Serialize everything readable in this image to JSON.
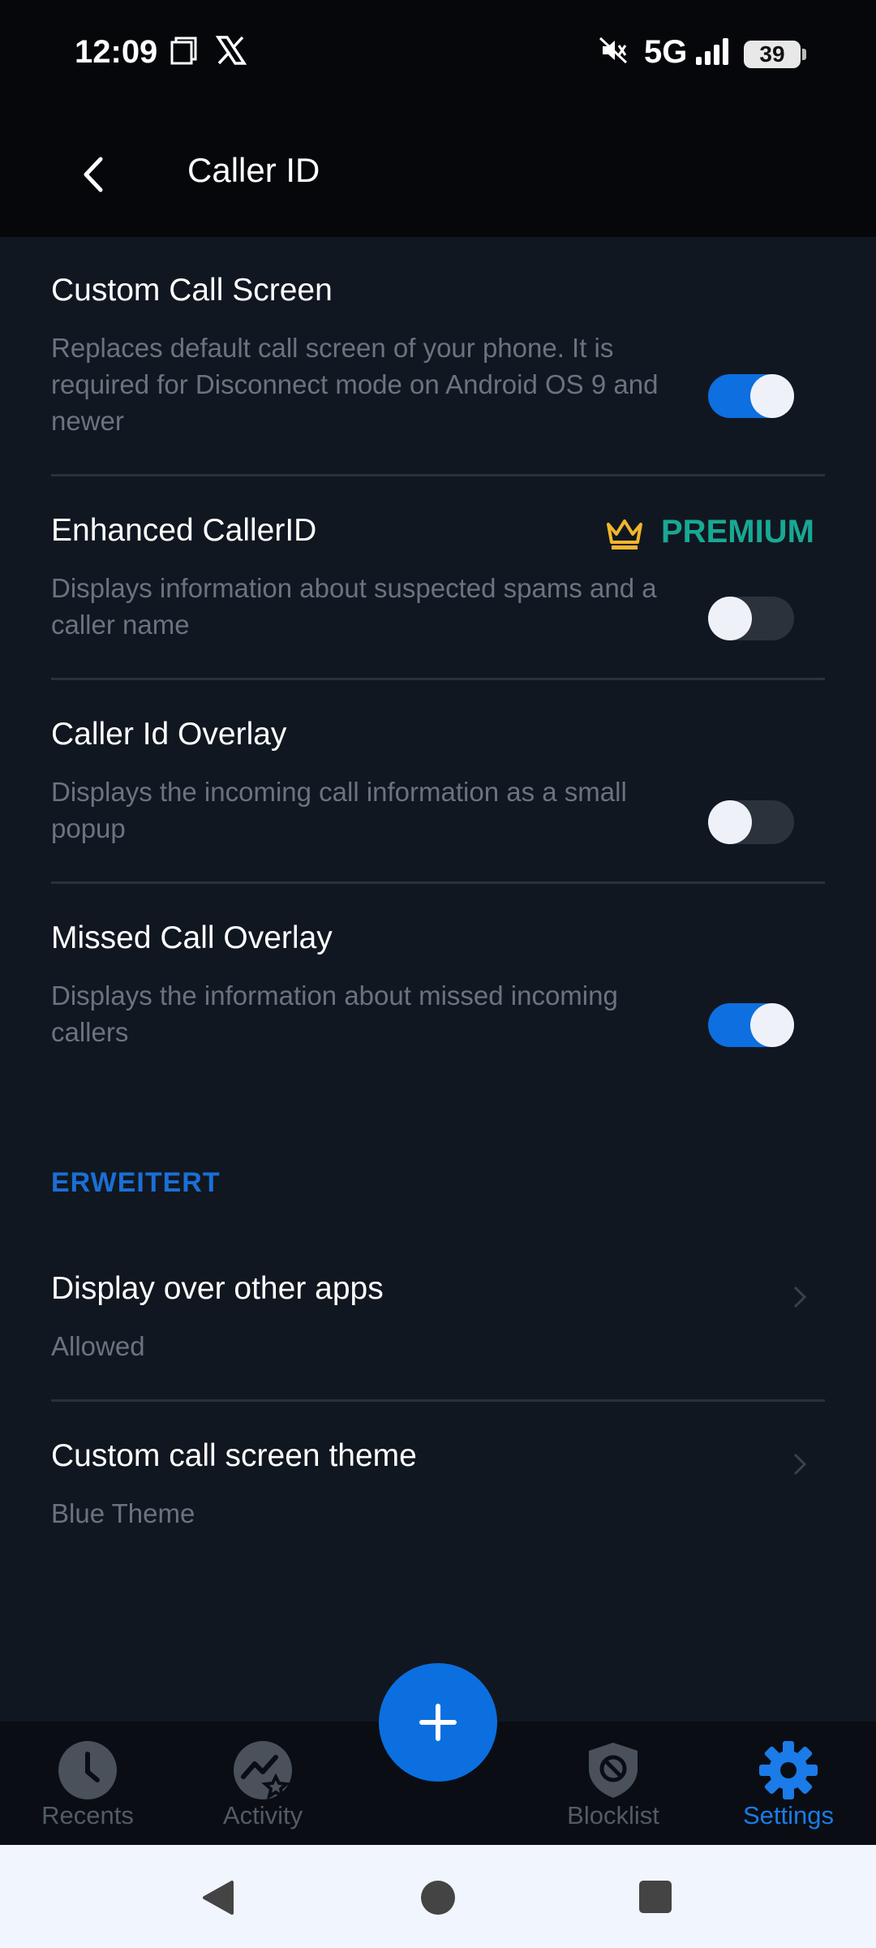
{
  "status_bar": {
    "time": "12:09",
    "network": "5G",
    "battery": "39",
    "icons": [
      "screenshot-icon",
      "x-app-icon",
      "mute-icon",
      "signal-icon",
      "battery-icon"
    ]
  },
  "app_bar": {
    "title": "Caller ID",
    "back_icon": "arrow-back-icon"
  },
  "settings": [
    {
      "title": "Custom Call Screen",
      "description": "Replaces default call screen of your phone. It is required for Disconnect mode on Android OS 9 and newer",
      "enabled": true
    },
    {
      "title": "Enhanced CallerID",
      "description": "Displays information about suspected spams and a caller name",
      "enabled": false,
      "badge": "PREMIUM"
    },
    {
      "title": "Caller Id Overlay",
      "description": "Displays the incoming call information as a small popup",
      "enabled": false
    },
    {
      "title": "Missed Call Overlay",
      "description": "Displays the information about missed incoming callers",
      "enabled": true
    }
  ],
  "advanced": {
    "header": "ERWEITERT",
    "items": [
      {
        "title": "Display over other apps",
        "value": "Allowed"
      },
      {
        "title": "Custom call screen theme",
        "value": "Blue Theme"
      }
    ]
  },
  "bottom_nav": {
    "items": [
      {
        "label": "Recents",
        "icon": "clock-icon",
        "active": false
      },
      {
        "label": "Activity",
        "icon": "activity-icon",
        "active": false
      },
      {
        "label": "Blocklist",
        "icon": "shield-block-icon",
        "active": false
      },
      {
        "label": "Settings",
        "icon": "gear-icon",
        "active": true
      }
    ],
    "fab_icon": "plus-icon"
  },
  "colors": {
    "accent": "#0d6fe0",
    "premium": "#18a894",
    "crown": "#f2b52c",
    "background": "#111720"
  }
}
